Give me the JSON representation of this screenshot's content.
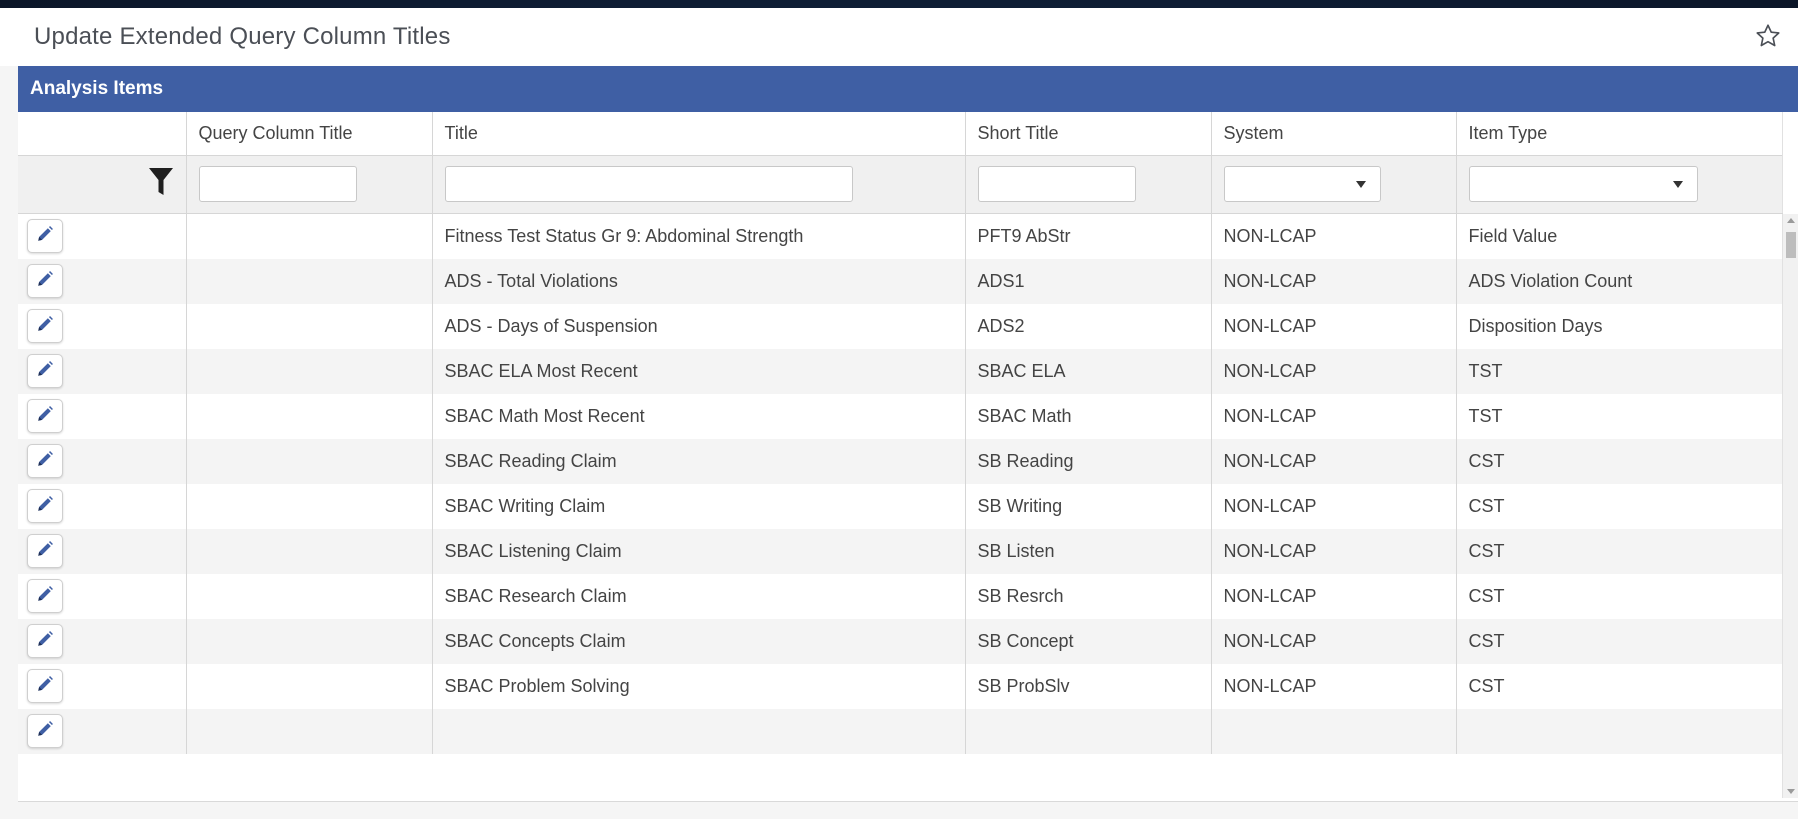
{
  "page": {
    "title": "Update Extended Query Column Titles",
    "favorite_icon": "star-outline-icon"
  },
  "grid": {
    "section_title": "Analysis Items",
    "columns": [
      "",
      "Query Column Title",
      "Title",
      "Short Title",
      "System",
      "Item Type"
    ],
    "filter_icon": "filter-funnel-icon",
    "filters": {
      "query_column_title": "",
      "title": "",
      "short_title": "",
      "system": "",
      "item_type": ""
    },
    "edit_icon": "pencil-icon",
    "rows": [
      {
        "query_column_title": "",
        "title": "Fitness Test Status Gr 9: Abdominal Strength",
        "short_title": "PFT9 AbStr",
        "system": "NON-LCAP",
        "item_type": "Field Value"
      },
      {
        "query_column_title": "",
        "title": "ADS - Total Violations",
        "short_title": "ADS1",
        "system": "NON-LCAP",
        "item_type": "ADS Violation Count"
      },
      {
        "query_column_title": "",
        "title": "ADS - Days of Suspension",
        "short_title": "ADS2",
        "system": "NON-LCAP",
        "item_type": "Disposition Days"
      },
      {
        "query_column_title": "",
        "title": "SBAC ELA Most Recent",
        "short_title": "SBAC ELA",
        "system": "NON-LCAP",
        "item_type": "TST"
      },
      {
        "query_column_title": "",
        "title": "SBAC Math Most Recent",
        "short_title": "SBAC Math",
        "system": "NON-LCAP",
        "item_type": "TST"
      },
      {
        "query_column_title": "",
        "title": "SBAC Reading Claim",
        "short_title": "SB Reading",
        "system": "NON-LCAP",
        "item_type": "CST"
      },
      {
        "query_column_title": "",
        "title": "SBAC Writing Claim",
        "short_title": "SB Writing",
        "system": "NON-LCAP",
        "item_type": "CST"
      },
      {
        "query_column_title": "",
        "title": "SBAC Listening Claim",
        "short_title": "SB Listen",
        "system": "NON-LCAP",
        "item_type": "CST"
      },
      {
        "query_column_title": "",
        "title": "SBAC Research Claim",
        "short_title": "SB Resrch",
        "system": "NON-LCAP",
        "item_type": "CST"
      },
      {
        "query_column_title": "",
        "title": "SBAC Concepts Claim",
        "short_title": "SB Concept",
        "system": "NON-LCAP",
        "item_type": "CST"
      },
      {
        "query_column_title": "",
        "title": "SBAC Problem Solving",
        "short_title": "SB ProbSlv",
        "system": "NON-LCAP",
        "item_type": "CST"
      },
      {
        "query_column_title": "",
        "title": "",
        "short_title": "",
        "system": "",
        "item_type": ""
      }
    ]
  },
  "colors": {
    "header_blue": "#3f5fa4",
    "edit_icon": "#3f5fa4",
    "background_frame": "#0d1b33"
  }
}
